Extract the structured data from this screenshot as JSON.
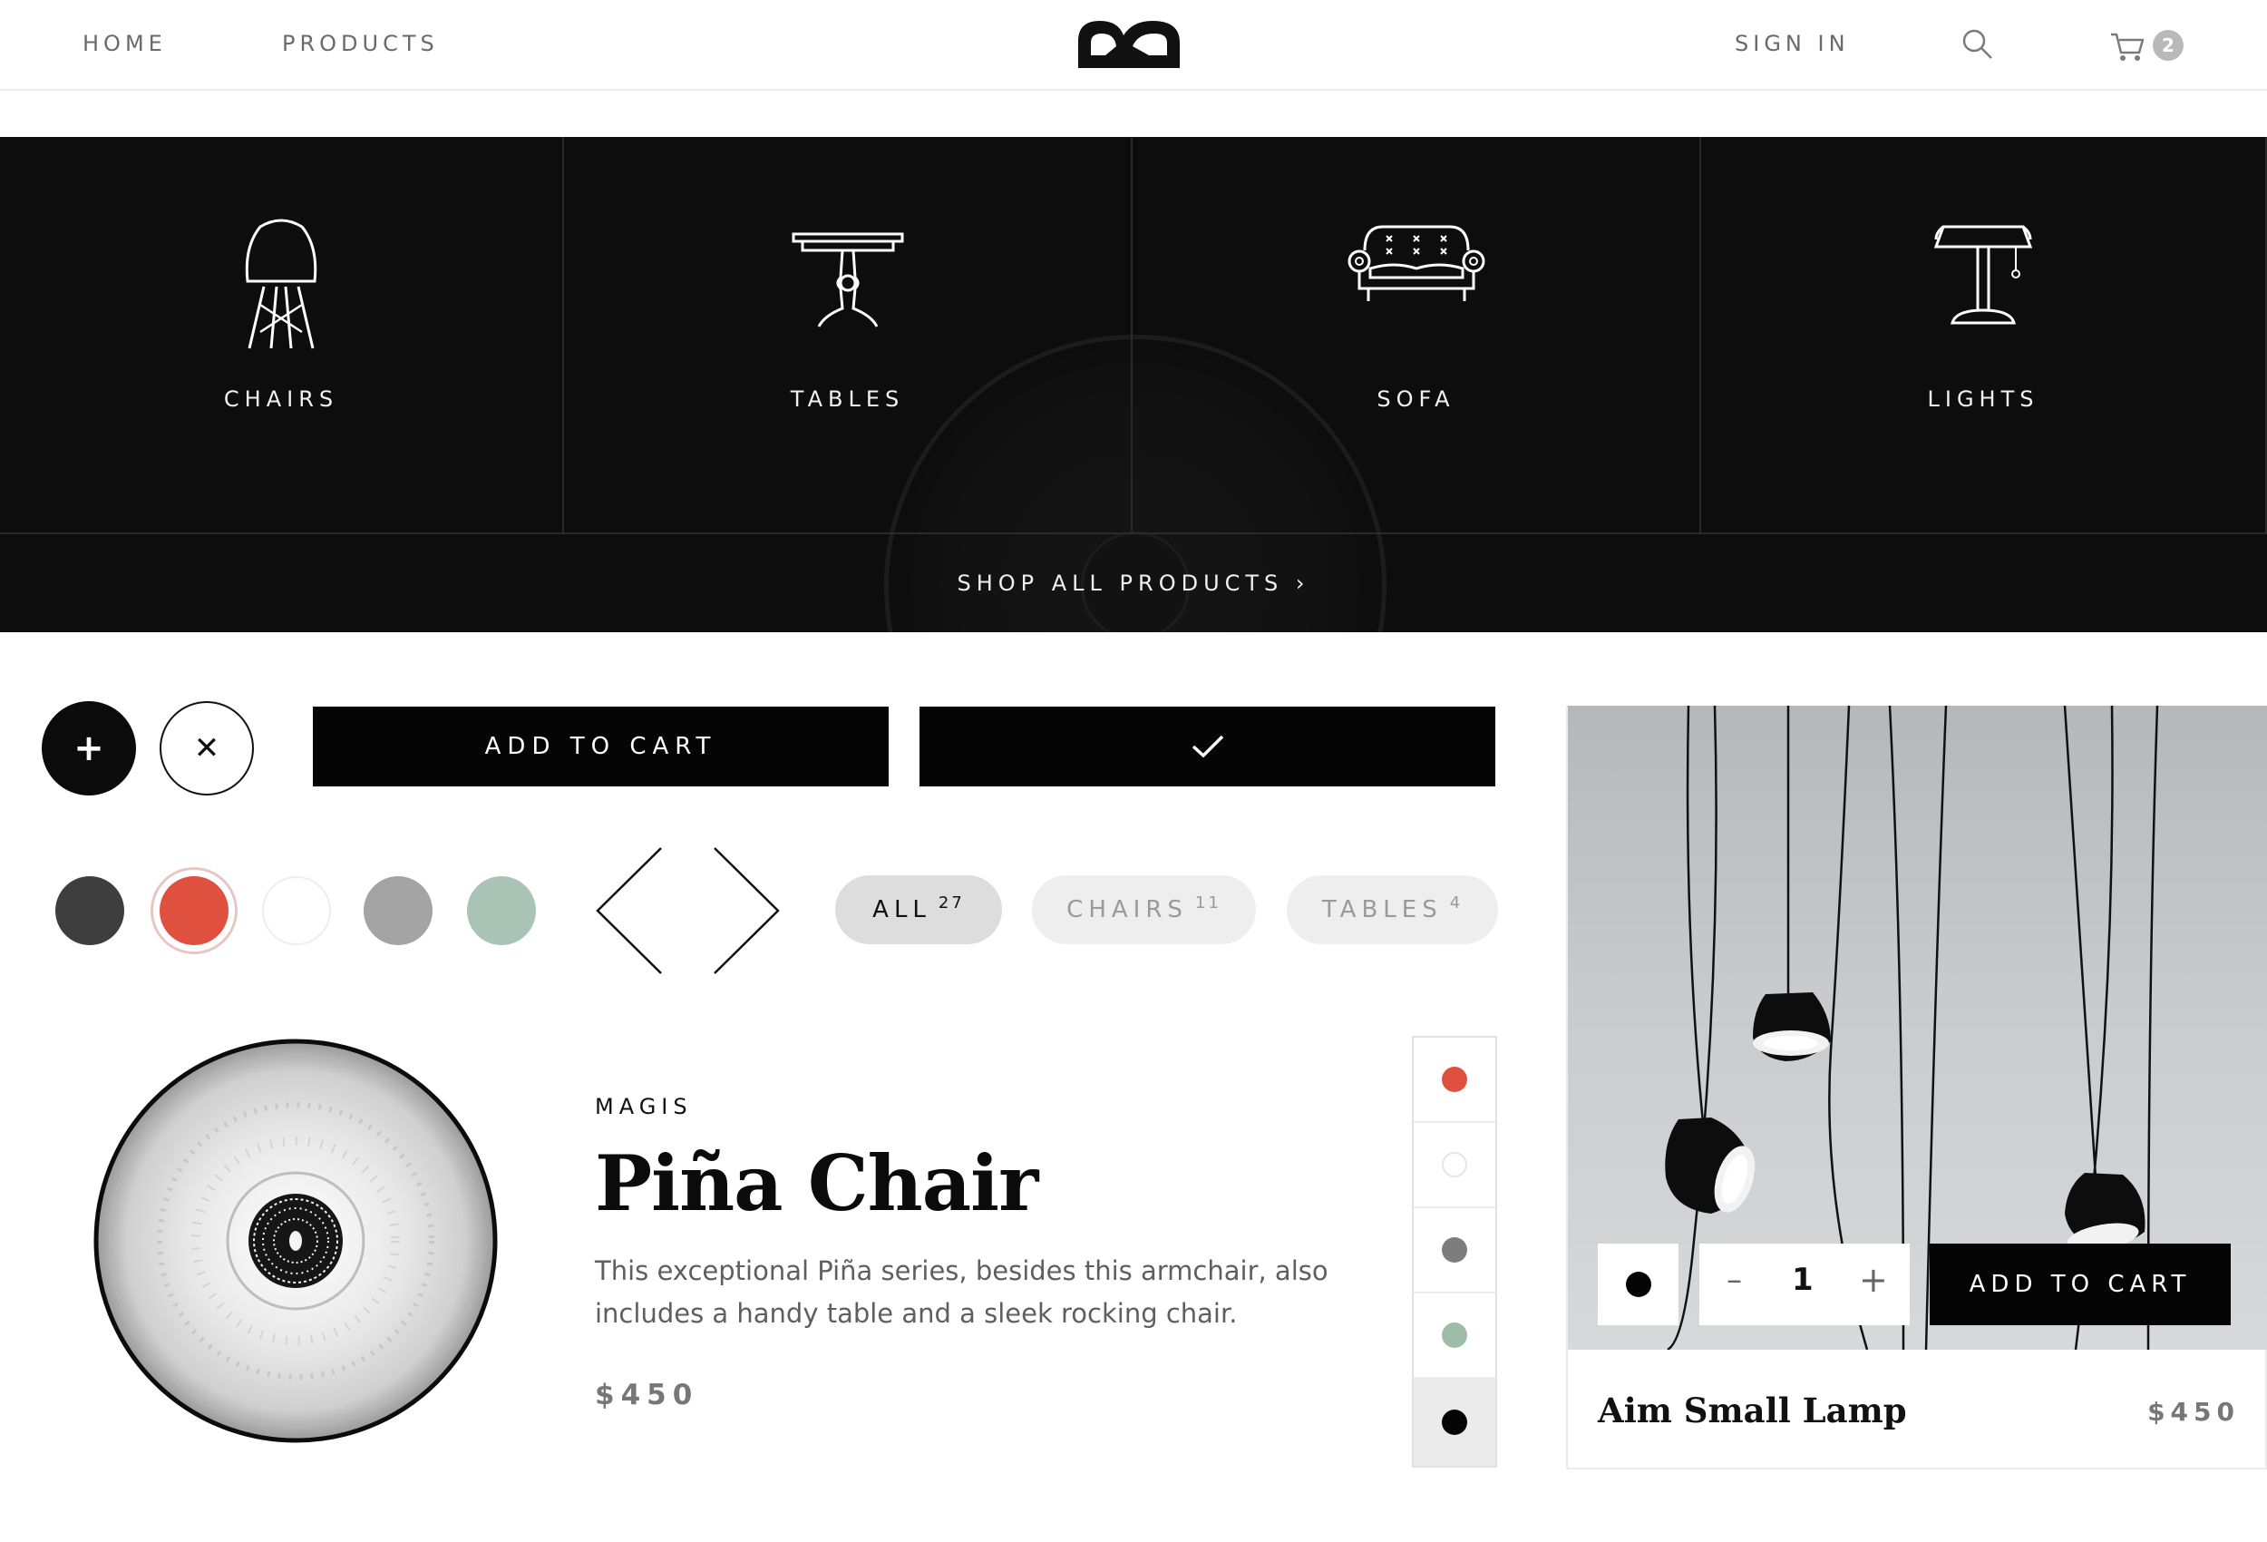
{
  "header": {
    "nav": [
      "HOME",
      "PRODUCTS"
    ],
    "sign_in": "SIGN IN",
    "cart_count": "2",
    "icons": [
      "logo-b-icon",
      "search-icon",
      "cart-icon"
    ]
  },
  "categories": {
    "items": [
      {
        "label": "CHAIRS",
        "icon": "chair-icon"
      },
      {
        "label": "TABLES",
        "icon": "table-icon"
      },
      {
        "label": "SOFA",
        "icon": "sofa-icon"
      },
      {
        "label": "LIGHTS",
        "icon": "lamp-icon"
      }
    ],
    "shop_all": "SHOP ALL PRODUCTS ›"
  },
  "buttons": {
    "plus": "+",
    "close": "✕",
    "add_to_cart": "ADD TO CART",
    "confirm_icon": "check-icon"
  },
  "swatches": {
    "colors": [
      "#3e3e3e",
      "#e0503e",
      "#ffffff",
      "#a4a4a4",
      "#a9c3b4"
    ],
    "selected_index": 1
  },
  "arrows": [
    "chevron-left-icon",
    "chevron-right-icon"
  ],
  "filters": [
    {
      "label": "ALL",
      "count": "27",
      "active": true
    },
    {
      "label": "CHAIRS",
      "count": "11",
      "active": false
    },
    {
      "label": "TABLES",
      "count": "4",
      "active": false
    }
  ],
  "product": {
    "brand": "MAGIS",
    "title": "Piña Chair",
    "description": "This exceptional Piña series, besides this armchair, also includes a handy table and a sleek rocking chair.",
    "price": "$450",
    "colors": [
      "#e0503e",
      "#ffffff",
      "#7d7d7d",
      "#9dbda9",
      "#050505"
    ],
    "selected_color_index": 4
  },
  "lamp_card": {
    "name": "Aim Small Lamp",
    "price": "$450",
    "quantity": "1",
    "minus": "–",
    "plus": "+",
    "add_to_cart": "ADD TO CART",
    "color": "#050505"
  }
}
